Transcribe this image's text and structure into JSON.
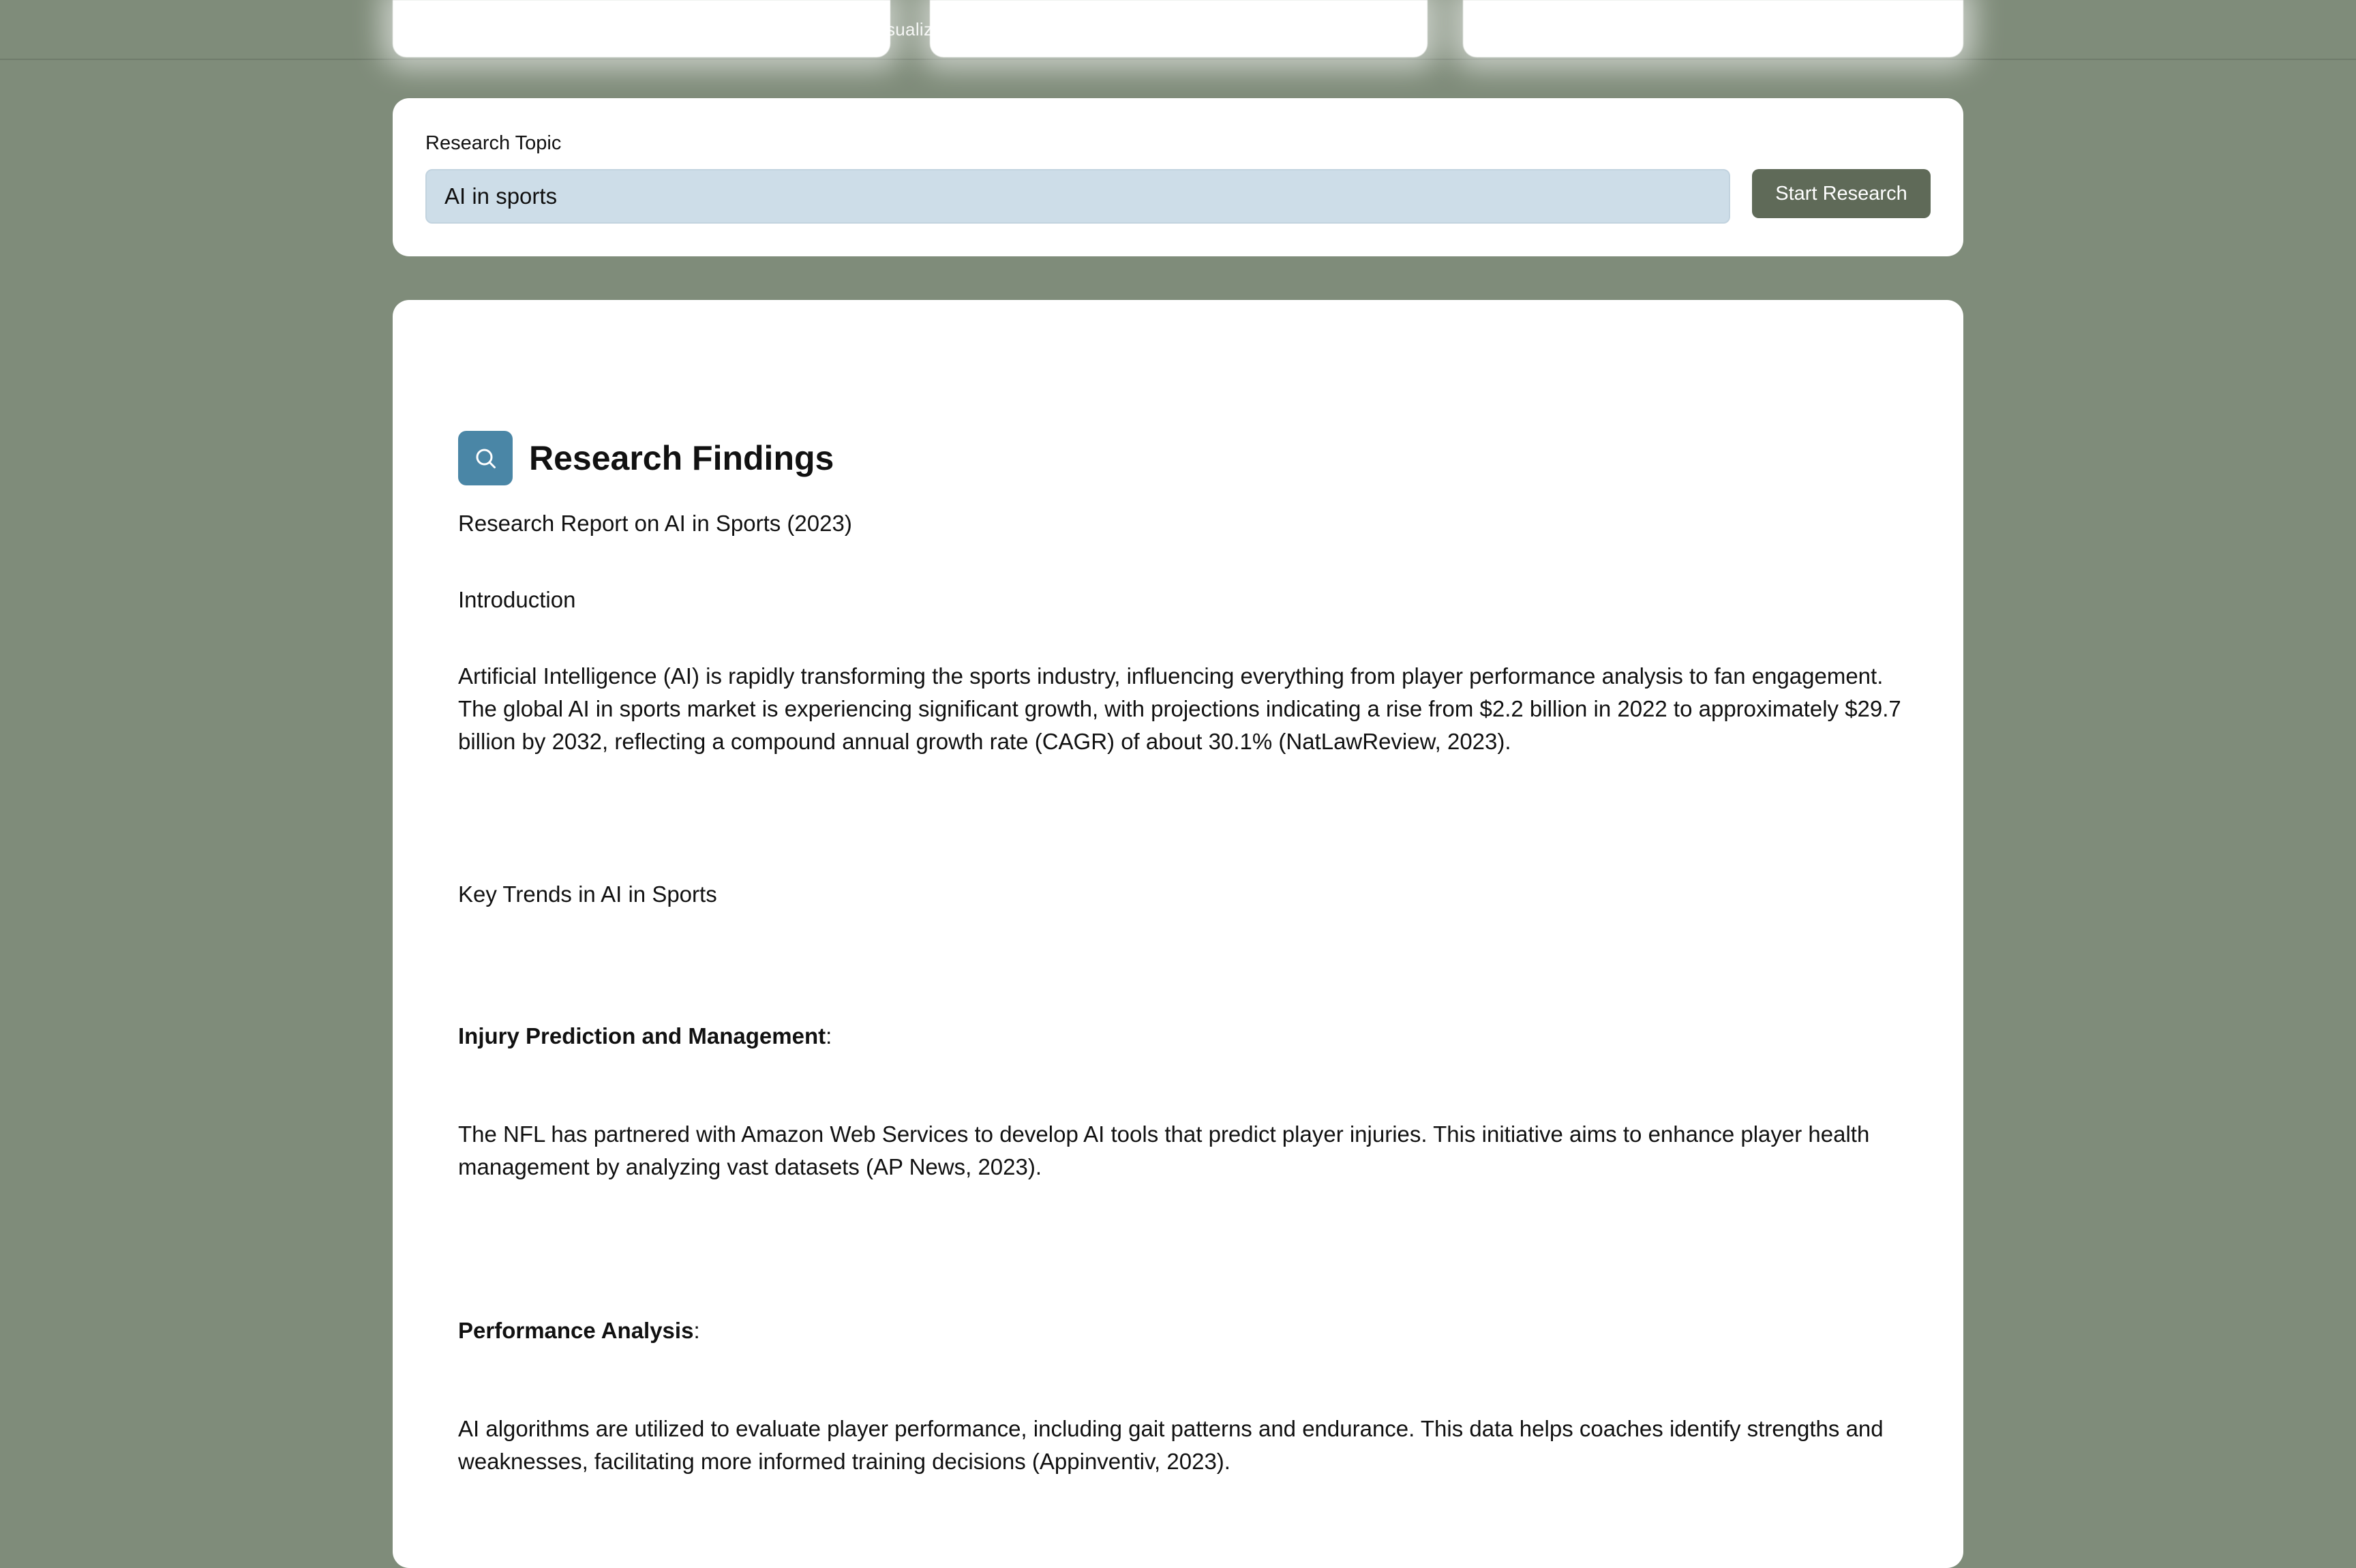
{
  "header": {
    "partial_label": "sualizer"
  },
  "topic": {
    "label": "Research Topic",
    "value": "AI in sports",
    "button_label": "Start Research"
  },
  "findings": {
    "title": "Research Findings",
    "report_title": "Research Report on AI in Sports (2023)",
    "intro_heading": "Introduction",
    "intro_body": "Artificial Intelligence (AI) is rapidly transforming the sports industry, influencing everything from player performance analysis to fan engagement. The global AI in sports market is experiencing significant growth, with projections indicating a rise from $2.2 billion in 2022 to approximately $29.7 billion by 2032, reflecting a compound annual growth rate (CAGR) of about 30.1% (NatLawReview, 2023).",
    "trends_heading": "Key Trends in AI in Sports",
    "items": [
      {
        "heading": "Injury Prediction and Management",
        "suffix": ":",
        "body": "The NFL has partnered with Amazon Web Services to develop AI tools that predict player injuries. This initiative aims to enhance player health management by analyzing vast datasets (AP News, 2023)."
      },
      {
        "heading": "Performance Analysis",
        "suffix": ":",
        "body": "AI algorithms are utilized to evaluate player performance, including gait patterns and endurance. This data helps coaches identify strengths and weaknesses, facilitating more informed training decisions (Appinventiv, 2023)."
      }
    ]
  },
  "icons": {
    "findings_icon": "search-icon"
  },
  "colors": {
    "page_background": "#7f8c7a",
    "button_background": "#5f6a58",
    "input_background": "#cddde8",
    "icon_badge": "#4a86a6"
  }
}
